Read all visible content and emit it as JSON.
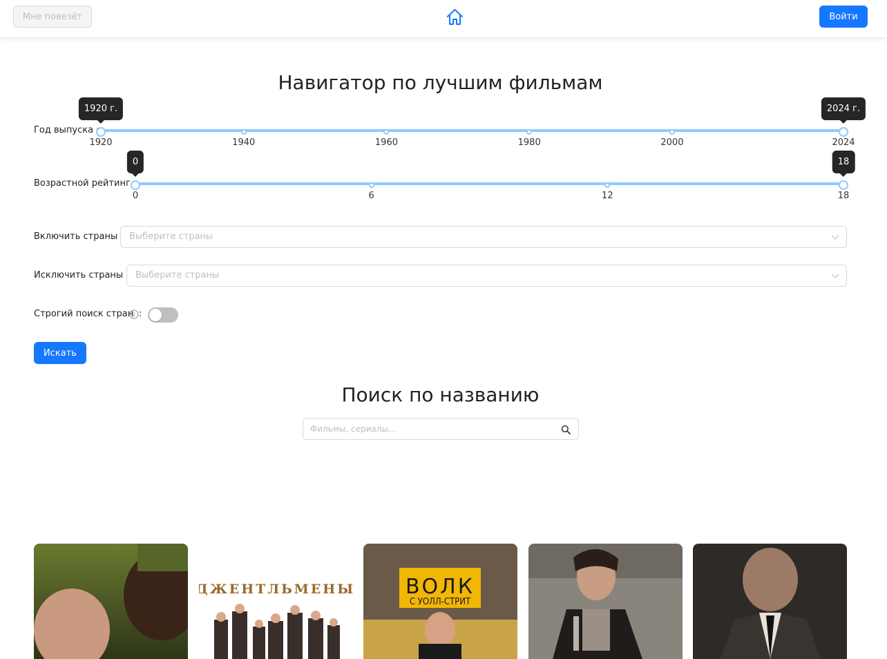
{
  "header": {
    "lucky_label": "Мне повезёт",
    "login_label": "Войти",
    "home_icon": "home-icon"
  },
  "navigator": {
    "title": "Навигатор по лучшим фильмам",
    "year": {
      "label": "Год выпуска",
      "min": 1920,
      "max": 2024,
      "value_from": 1920,
      "value_to": 2024,
      "tip_from": "1920 г.",
      "tip_to": "2024 г.",
      "marks": [
        "1920",
        "1940",
        "1960",
        "1980",
        "2000",
        "2024"
      ]
    },
    "age": {
      "label": "Возрастной рейтинг",
      "min": 0,
      "max": 18,
      "value_from": 0,
      "value_to": 18,
      "tip_from": "0",
      "tip_to": "18",
      "marks": [
        "0",
        "6",
        "12",
        "18"
      ]
    },
    "include_countries": {
      "label": "Включить страны",
      "placeholder": "Выберите страны"
    },
    "exclude_countries": {
      "label": "Исключить страны",
      "placeholder": "Выберите страны"
    },
    "strict": {
      "label": "Строгий поиск стран",
      "checked": false
    },
    "search_label": "Искать"
  },
  "title_search": {
    "title": "Поиск по названию",
    "placeholder": "Фильмы, сериалы..."
  },
  "posters": [
    {
      "title": "",
      "colors": [
        "#7a8a3a",
        "#3f4a1f"
      ]
    },
    {
      "title": "ДЖЕНТЛЬМЕНЫ",
      "colors": [
        "#ffffff",
        "#d9d9d9"
      ]
    },
    {
      "title": "ВОЛК",
      "subtitle": "С УОЛЛ-СТРИТ",
      "colors": [
        "#f2b705",
        "#5a4a3a"
      ]
    },
    {
      "title": "",
      "colors": [
        "#8a8a85",
        "#3a3530"
      ]
    },
    {
      "title": "",
      "colors": [
        "#3a3633",
        "#1a1816"
      ]
    }
  ]
}
